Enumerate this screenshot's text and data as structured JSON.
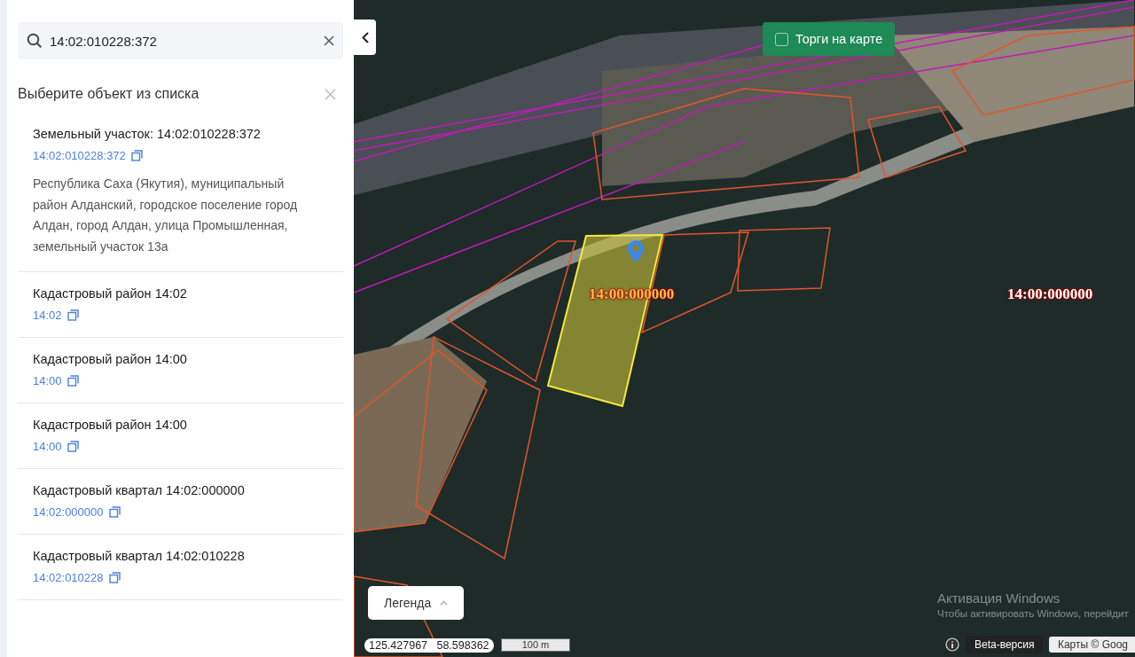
{
  "search": {
    "value": "14:02:010228:372"
  },
  "list": {
    "title": "Выберите объект из списка"
  },
  "results": [
    {
      "title": "Земельный участок: 14:02:010228:372",
      "link": "14:02:010228:372",
      "address": "Республика Саха (Якутия), муниципальный район Алданский, городское поселение город Алдан, город Алдан, улица Промышленная, земельный участок 13а"
    },
    {
      "title": "Кадастровый район 14:02",
      "link": "14:02"
    },
    {
      "title": "Кадастровый район 14:00",
      "link": "14:00"
    },
    {
      "title": "Кадастровый район 14:00",
      "link": "14:00"
    },
    {
      "title": "Кадастровый квартал 14:02:000000",
      "link": "14:02:000000"
    },
    {
      "title": "Кадастровый квартал 14:02:010228",
      "link": "14:02:010228"
    }
  ],
  "map": {
    "toggle": {
      "label": "Торги на карте",
      "checked": false
    },
    "parcel_labels": [
      {
        "text": "14:00:000000",
        "selected": true
      },
      {
        "text": "14:00:000000",
        "selected": false
      }
    ],
    "legend": {
      "label": "Легенда"
    },
    "coordinates": "125.427967   58.598362",
    "scale": "100 m",
    "beta": "Beta-версия",
    "attribution": "Карты © Goog",
    "os_notice": {
      "title": "Активация Windows",
      "text": "Чтобы активировать Windows, перейдит"
    }
  }
}
